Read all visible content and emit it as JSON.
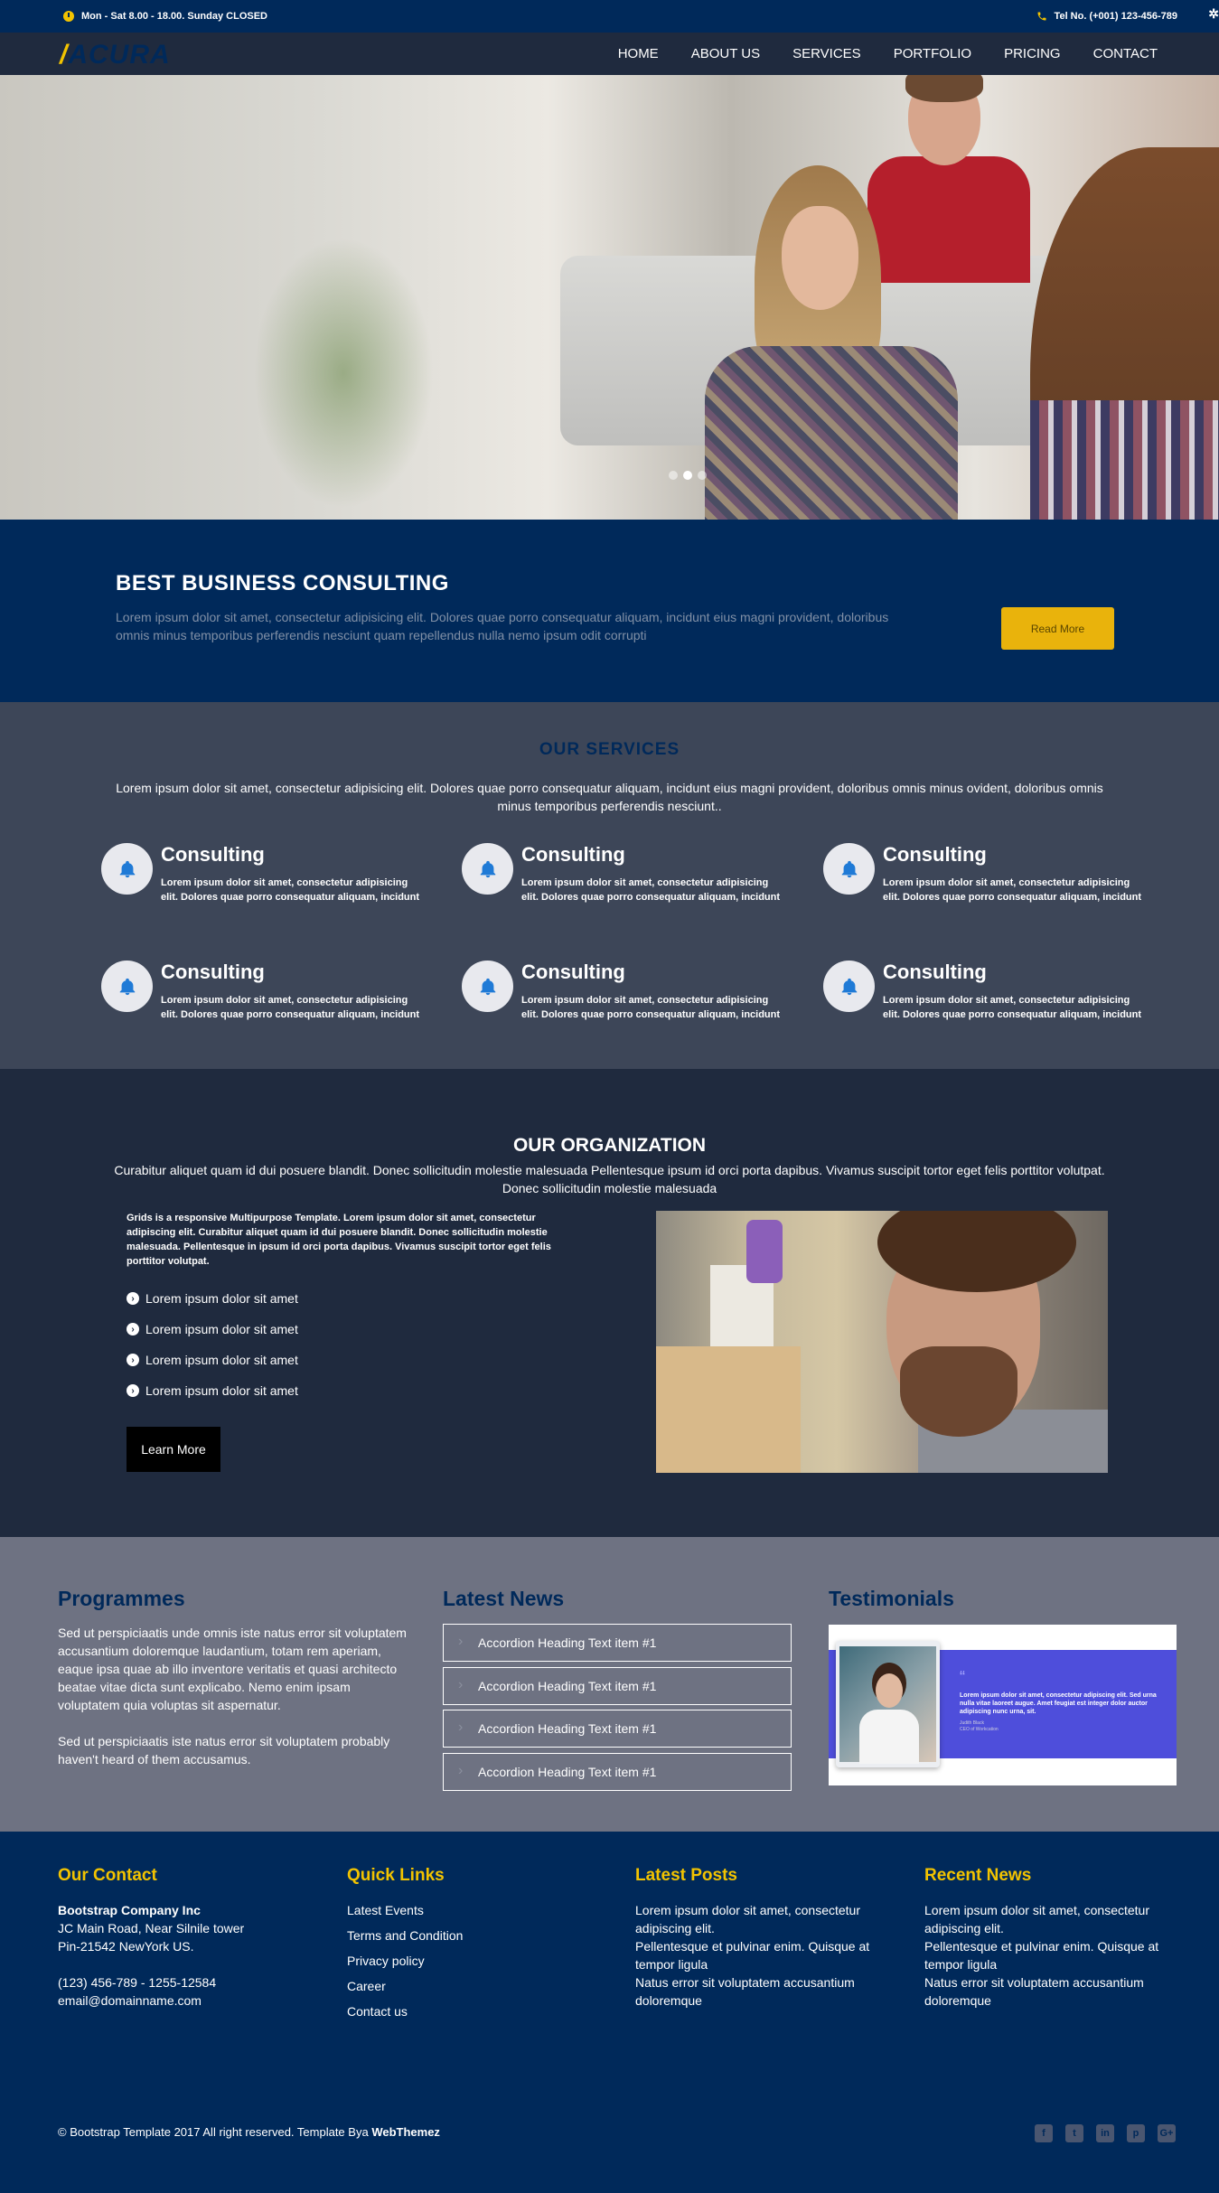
{
  "topbar": {
    "hours": "Mon - Sat 8.00 - 18.00. Sunday CLOSED",
    "phone": "Tel No. (+001) 123-456-789"
  },
  "nav": {
    "logo_slash": "/",
    "logo_word": "ACURA",
    "items": [
      "HOME",
      "ABOUT US",
      "SERVICES",
      "PORTFOLIO",
      "PRICING",
      "CONTACT"
    ]
  },
  "banner": {
    "title": "BEST BUSINESS CONSULTING",
    "text": "Lorem ipsum dolor sit amet, consectetur adipisicing elit. Dolores quae porro consequatur aliquam, incidunt eius magni provident, doloribus omnis minus temporibus perferendis nesciunt quam repellendus nulla nemo ipsum odit corrupti",
    "button": "Read More"
  },
  "services": {
    "title": "OUR SERVICES",
    "intro": "Lorem ipsum dolor sit amet, consectetur adipisicing elit. Dolores quae porro consequatur aliquam, incidunt eius magni provident, doloribus omnis minus ovident, doloribus omnis minus temporibus perferendis nesciunt..",
    "items": [
      {
        "title": "Consulting",
        "desc": "Lorem ipsum dolor sit amet, consectetur adipisicing elit. Dolores quae porro consequatur aliquam, incidunt"
      },
      {
        "title": "Consulting",
        "desc": "Lorem ipsum dolor sit amet, consectetur adipisicing elit. Dolores quae porro consequatur aliquam, incidunt"
      },
      {
        "title": "Consulting",
        "desc": "Lorem ipsum dolor sit amet, consectetur adipisicing elit. Dolores quae porro consequatur aliquam, incidunt"
      },
      {
        "title": "Consulting",
        "desc": "Lorem ipsum dolor sit amet, consectetur adipisicing elit. Dolores quae porro consequatur aliquam, incidunt"
      },
      {
        "title": "Consulting",
        "desc": "Lorem ipsum dolor sit amet, consectetur adipisicing elit. Dolores quae porro consequatur aliquam, incidunt"
      },
      {
        "title": "Consulting",
        "desc": "Lorem ipsum dolor sit amet, consectetur adipisicing elit. Dolores quae porro consequatur aliquam, incidunt"
      }
    ]
  },
  "organization": {
    "title": "OUR ORGANIZATION",
    "intro": "Curabitur aliquet quam id dui posuere blandit. Donec sollicitudin molestie malesuada Pellentesque ipsum id orci porta dapibus. Vivamus suscipit tortor eget felis porttitor volutpat. Donec sollicitudin molestie malesuada",
    "body": "Grids is a responsive Multipurpose Template. Lorem ipsum dolor sit amet, consectetur adipiscing elit. Curabitur aliquet quam id dui posuere blandit. Donec sollicitudin molestie malesuada. Pellentesque in ipsum id orci porta dapibus. Vivamus suscipit tortor eget felis porttitor volutpat.",
    "list": [
      "Lorem ipsum dolor sit amet",
      "Lorem ipsum dolor sit amet",
      "Lorem ipsum dolor sit amet",
      "Lorem ipsum dolor sit amet"
    ],
    "button": "Learn More"
  },
  "programmes": {
    "title": "Programmes",
    "p1": "Sed ut perspiciaatis unde omnis iste natus error sit voluptatem accusantium doloremque laudantium, totam rem aperiam, eaque ipsa quae ab illo inventore veritatis et quasi architecto beatae vitae dicta sunt explicabo. Nemo enim ipsam voluptatem quia voluptas sit aspernatur.",
    "p2": "Sed ut perspiciaatis iste natus error sit voluptatem probably haven't heard of them accusamus."
  },
  "news": {
    "title": "Latest News",
    "items": [
      "Accordion Heading Text item #1",
      "Accordion Heading Text item #1",
      "Accordion Heading Text item #1",
      "Accordion Heading Text item #1"
    ]
  },
  "testimonials": {
    "title": "Testimonials",
    "quote_mark": "“",
    "text": "Lorem ipsum dolor sit amet, consectetur adipiscing elit. Sed urna nulla vitae laoreet augue. Amet feugiat est integer dolor auctor adipiscing nunc urna, sit.",
    "name": "Judith Black",
    "role": "CEO of Workcation"
  },
  "footer": {
    "contact": {
      "title": "Our Contact",
      "company": "Bootstrap Company Inc",
      "address1": "JC Main Road, Near Silnile tower",
      "address2": "Pin-21542 NewYork US.",
      "phone": "(123) 456-789 - 1255-12584",
      "email": "email@domainname.com"
    },
    "quick_links": {
      "title": "Quick Links",
      "items": [
        "Latest Events",
        "Terms and Condition",
        "Privacy policy",
        "Career",
        "Contact us"
      ]
    },
    "latest_posts": {
      "title": "Latest Posts",
      "items": [
        "Lorem ipsum dolor sit amet, consectetur adipiscing elit.",
        "Pellentesque et pulvinar enim. Quisque at tempor ligula",
        "Natus error sit voluptatem accusantium doloremque"
      ]
    },
    "recent_news": {
      "title": "Recent News",
      "items": [
        "Lorem ipsum dolor sit amet, consectetur adipiscing elit.",
        "Pellentesque et pulvinar enim. Quisque at tempor ligula",
        "Natus error sit voluptatem accusantium doloremque"
      ]
    },
    "copyright": "© Bootstrap Template 2017 All right reserved. Template Bya",
    "copyright_brand": "WebThemez",
    "social": [
      "facebook-icon",
      "twitter-icon",
      "linkedin-icon",
      "pinterest-icon",
      "google-plus-icon"
    ]
  },
  "colors": {
    "navy": "#00295a",
    "accent": "#f2c300",
    "button": "#e9b30c"
  }
}
